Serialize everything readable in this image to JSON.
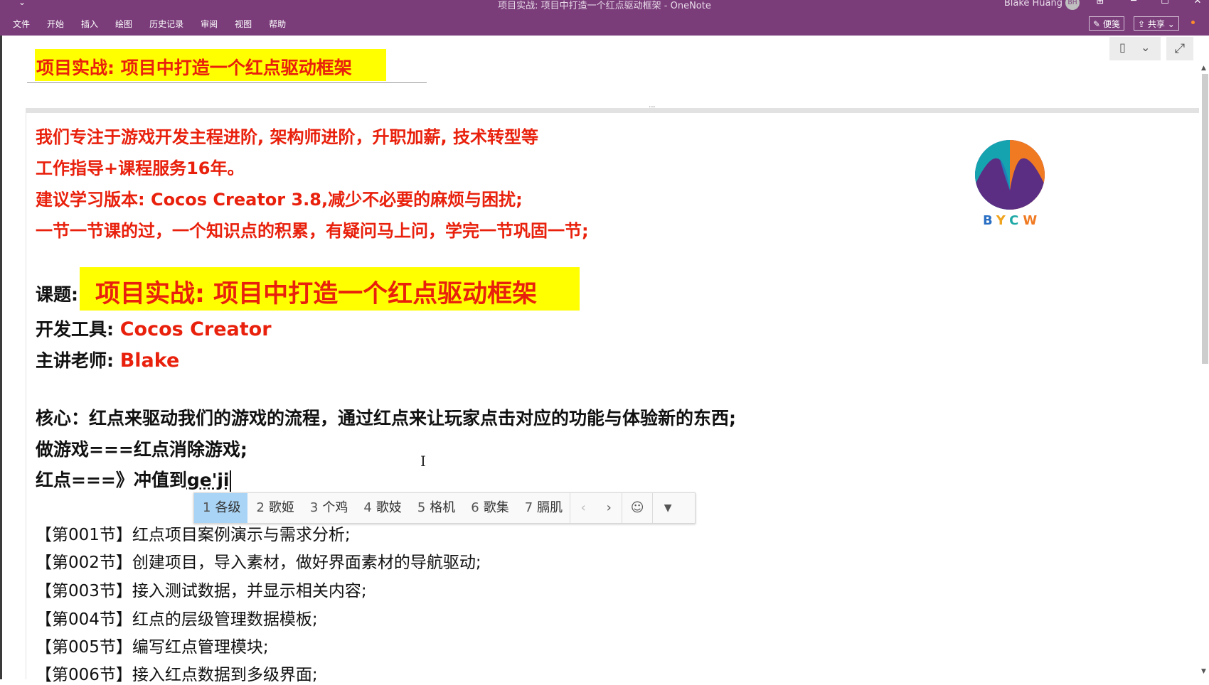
{
  "window": {
    "title": "项目实战: 项目中打造一个红点驱动框架   -  OneNote",
    "user": "Blake Huang",
    "user_initials": "BH",
    "qat_glyph": "⌄",
    "controls": {
      "restore_pane": "⊞",
      "minimize": "─",
      "maximize": "☐",
      "close": "✕"
    }
  },
  "menu": [
    "文件",
    "开始",
    "插入",
    "绘图",
    "历史记录",
    "审阅",
    "视图",
    "帮助"
  ],
  "toolbar": {
    "sticky_label": "便笺",
    "share_label": "共享"
  },
  "page": {
    "title": "项目实战: 项目中打造一个红点驱动框架",
    "intro": [
      "我们专注于游戏开发主程进阶, 架构师进阶，升职加薪, 技术转型等",
      "工作指导+课程服务16年。",
      "建议学习版本: Cocos Creator 3.8,减少不必要的麻烦与困扰;",
      "一节一节课的过，一个知识点的积累，有疑问马上问，学完一节巩固一节;"
    ],
    "topic_label": "课题:",
    "topic_value": "项目实战: 项目中打造一个红点驱动框架",
    "tool_label": "开发工具:",
    "tool_value": "Cocos Creator",
    "teacher_label": "主讲老师:",
    "teacher_value": "Blake",
    "core": "核心：红点来驱动我们的游戏的流程，通过红点来让玩家点击对应的功能与体验新的东西;",
    "line_game": "做游戏===红点消除游戏;",
    "line_red_prefix": "红点===》冲值到",
    "line_red_composing": "ge'ji",
    "sections": [
      "【第001节】红点项目案例演示与需求分析;",
      "【第002节】创建项目，导入素材，做好界面素材的导航驱动;",
      "【第003节】接入测试数据，并显示相关内容;",
      "【第004节】红点的层级管理数据模板;",
      "【第005节】编写红点管理模块;",
      "【第006节】接入红点数据到多级界面;"
    ]
  },
  "logo": {
    "letters": [
      "B",
      "Y",
      "C",
      "W"
    ]
  },
  "ime": {
    "candidates": [
      {
        "num": "1",
        "text": "各级"
      },
      {
        "num": "2",
        "text": "歌姬"
      },
      {
        "num": "3",
        "text": "个鸡"
      },
      {
        "num": "4",
        "text": "歌妓"
      },
      {
        "num": "5",
        "text": "格机"
      },
      {
        "num": "6",
        "text": "歌集"
      },
      {
        "num": "7",
        "text": "膈肌"
      }
    ],
    "prev": "‹",
    "next": "›",
    "emoji": "☺",
    "more": "▼"
  },
  "icons": {
    "view_toggle": "▯",
    "view_dropdown": "⌄",
    "fullscreen": "⤢",
    "scroll_up": "▲",
    "scroll_down": "▼",
    "ibeam": "I"
  },
  "colors": {
    "titlebar": "#7a3d7a",
    "highlight": "#ffff00",
    "accent_red": "#e8200c"
  }
}
